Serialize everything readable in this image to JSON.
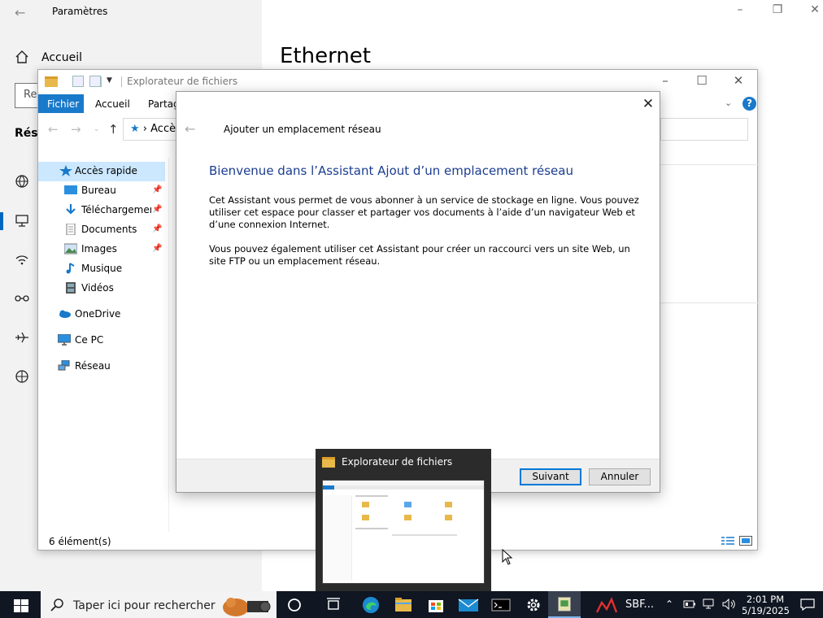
{
  "settings": {
    "title": "Paramètres",
    "home_label": "Accueil",
    "search_text": "Re",
    "section_label": "Rése",
    "heading": "Ethernet"
  },
  "explorer": {
    "title": "Explorateur de fichiers",
    "ribbon_tabs": [
      "Fichier",
      "Accueil",
      "Partage"
    ],
    "help_label": "?",
    "address_path": "Accè",
    "nav_items": [
      {
        "label": "Accès rapide",
        "icon": "star-icon",
        "pinned": false,
        "selected": true
      },
      {
        "label": "Bureau",
        "icon": "desktop-folder-icon",
        "pinned": true
      },
      {
        "label": "Téléchargements",
        "icon": "download-folder-icon",
        "pinned": true
      },
      {
        "label": "Documents",
        "icon": "documents-folder-icon",
        "pinned": true
      },
      {
        "label": "Images",
        "icon": "images-folder-icon",
        "pinned": true
      },
      {
        "label": "Musique",
        "icon": "music-folder-icon",
        "pinned": false
      },
      {
        "label": "Vidéos",
        "icon": "videos-folder-icon",
        "pinned": false
      },
      {
        "label": "OneDrive",
        "icon": "onedrive-icon",
        "pinned": false
      },
      {
        "label": "Ce PC",
        "icon": "computer-icon",
        "pinned": false
      },
      {
        "label": "Réseau",
        "icon": "network-icon",
        "pinned": false
      }
    ],
    "status_text": "6 élément(s)"
  },
  "wizard": {
    "header": "Ajouter un emplacement réseau",
    "heading": "Bienvenue dans l’Assistant Ajout d’un emplacement réseau",
    "paragraph1": "Cet Assistant vous permet de vous abonner à un service de stockage en ligne. Vous pouvez utiliser cet espace pour classer et partager vos documents à l’aide d’un navigateur Web et d’une connexion Internet.",
    "paragraph2": "Vous pouvez également utiliser cet Assistant pour créer un raccourci vers un site Web, un site FTP ou un emplacement réseau.",
    "next_label": "Suivant",
    "cancel_label": "Annuler"
  },
  "thumbnail": {
    "title": "Explorateur de fichiers"
  },
  "taskbar": {
    "search_placeholder": "Taper ici pour rechercher",
    "pinned_app_label": "SBF...",
    "time": "2:01 PM",
    "date": "5/19/2025",
    "apps": [
      "cortana-icon",
      "task-view-icon",
      "edge-icon",
      "file-explorer-icon",
      "store-icon",
      "mail-icon",
      "terminal-icon",
      "settings-gear-icon",
      "network-wizard-icon"
    ]
  },
  "colors": {
    "accent": "#1979ca",
    "taskbar_bg": "#101622",
    "wizard_heading": "#1b3d8f",
    "selection": "#cce8ff"
  }
}
